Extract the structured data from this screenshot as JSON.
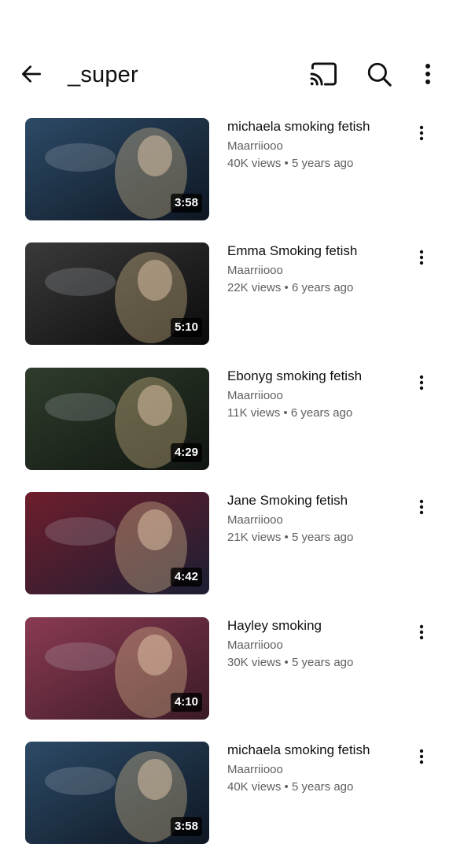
{
  "header": {
    "title": "_super",
    "back_icon": "arrow-left-icon",
    "cast_icon": "cast-icon",
    "search_icon": "search-icon",
    "more_icon": "more-vertical-icon"
  },
  "videos": [
    {
      "title": "michaela smoking fetish",
      "channel": "Maarriiooo",
      "views": "40K views",
      "age": "5 years ago",
      "duration": "3:58",
      "thumb_colors": [
        "#2c4a66",
        "#0e1622"
      ]
    },
    {
      "title": "Emma Smoking fetish",
      "channel": "Maarriiooo",
      "views": "22K views",
      "age": "6 years ago",
      "duration": "5:10",
      "thumb_colors": [
        "#3a3a3a",
        "#0a0a0a"
      ]
    },
    {
      "title": "Ebonyg smoking fetish",
      "channel": "Maarriiooo",
      "views": "11K views",
      "age": "6 years ago",
      "duration": "4:29",
      "thumb_colors": [
        "#2f3d2c",
        "#101510"
      ]
    },
    {
      "title": "Jane Smoking fetish",
      "channel": "Maarriiooo",
      "views": "21K views",
      "age": "5 years ago",
      "duration": "4:42",
      "thumb_colors": [
        "#6e1e2c",
        "#1c1e33"
      ]
    },
    {
      "title": "Hayley smoking",
      "channel": "Maarriiooo",
      "views": "30K views",
      "age": "5 years ago",
      "duration": "4:10",
      "thumb_colors": [
        "#8a3a52",
        "#3a1a26"
      ]
    },
    {
      "title": "michaela smoking fetish",
      "channel": "Maarriiooo",
      "views": "40K views",
      "age": "5 years ago",
      "duration": "3:58",
      "thumb_colors": [
        "#2c4a66",
        "#0e1622"
      ]
    }
  ]
}
